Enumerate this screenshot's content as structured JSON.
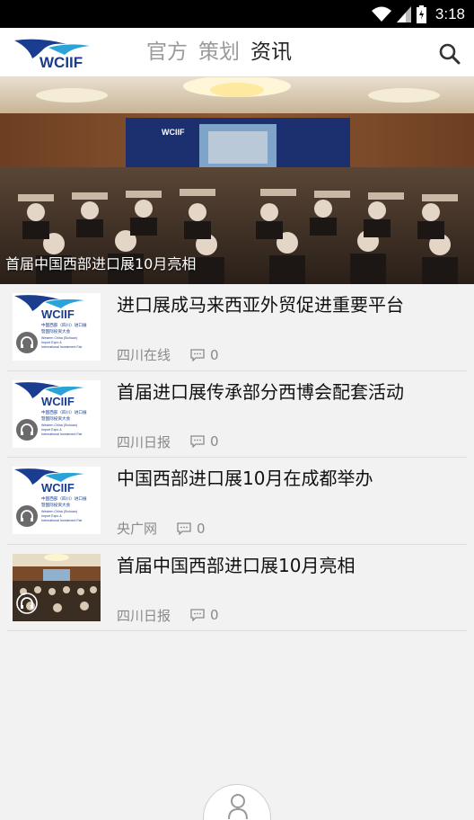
{
  "status_bar": {
    "time": "3:18"
  },
  "header": {
    "logo_text": "WCIIF",
    "tabs": [
      {
        "label": "官方",
        "active": false
      },
      {
        "label": "策划",
        "active": false
      },
      {
        "label": "资讯",
        "active": true
      }
    ]
  },
  "banner": {
    "caption": "首届中国西部进口展10月亮相",
    "screen_text": "WCIIF"
  },
  "news": [
    {
      "title": "进口展成马来西亚外贸促进重要平台",
      "source": "四川在线",
      "comments": "0",
      "thumb": "logo"
    },
    {
      "title": "首届进口展传承部分西博会配套活动",
      "source": "四川日报",
      "comments": "0",
      "thumb": "logo"
    },
    {
      "title": "中国西部进口展10月在成都举办",
      "source": "央广网",
      "comments": "0",
      "thumb": "logo"
    },
    {
      "title": "首届中国西部进口展10月亮相",
      "source": "四川日报",
      "comments": "0",
      "thumb": "photo"
    }
  ],
  "thumb_logo": {
    "brand": "WCIIF",
    "cn_line1": "中国西部（四川）进口展",
    "cn_line2": "暨国际投资大会",
    "en_line1": "Western China (Sichuan)",
    "en_line2": "Import Expo &",
    "en_line3": "International Investment Fair"
  },
  "colors": {
    "brand_blue": "#1a3d8f",
    "active_tab": "#222222",
    "inactive_tab": "#9a9a9a"
  }
}
